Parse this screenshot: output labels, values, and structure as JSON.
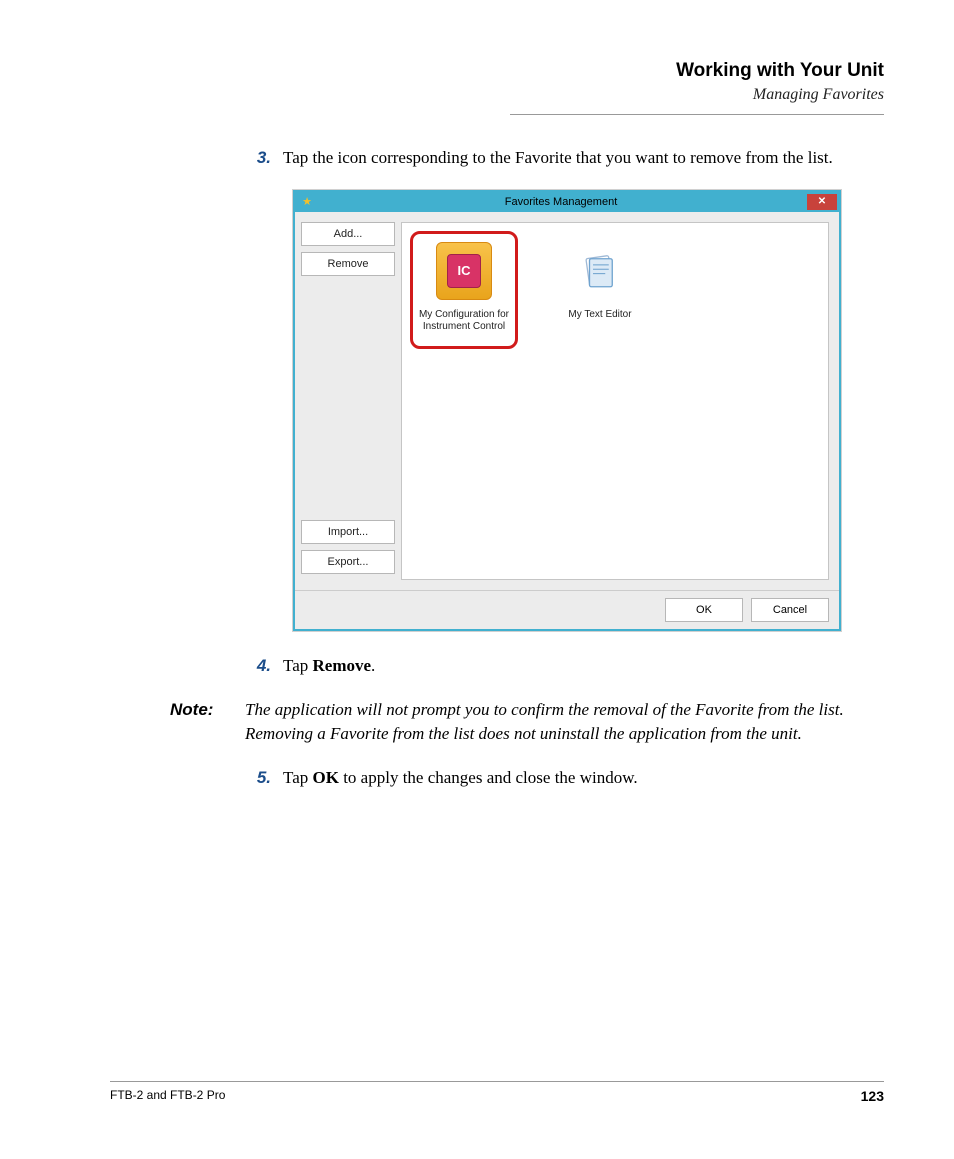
{
  "header": {
    "title": "Working with Your Unit",
    "subtitle": "Managing Favorites"
  },
  "steps": {
    "s3": {
      "num": "3.",
      "text": "Tap the icon corresponding to the Favorite that you want to remove from the list."
    },
    "s4": {
      "num": "4.",
      "prefix": "Tap ",
      "bold": "Remove",
      "suffix": "."
    },
    "s5": {
      "num": "5.",
      "prefix": "Tap ",
      "bold": "OK",
      "suffix": " to apply the changes and close the window."
    }
  },
  "note": {
    "label": "Note:",
    "text": "The application will not prompt you to confirm the removal of the Favorite from the list. Removing a Favorite from the list does not uninstall the application from the unit."
  },
  "window": {
    "title": "Favorites Management",
    "sidebar": {
      "add": "Add...",
      "remove": "Remove",
      "import": "Import...",
      "export": "Export..."
    },
    "tiles": {
      "t1": {
        "label": "My Configuration for Instrument Control",
        "badge": "IC"
      },
      "t2": {
        "label": "My Text Editor"
      }
    },
    "ok": "OK",
    "cancel": "Cancel"
  },
  "footer": {
    "doc": "FTB-2 and FTB-2 Pro",
    "page": "123"
  }
}
